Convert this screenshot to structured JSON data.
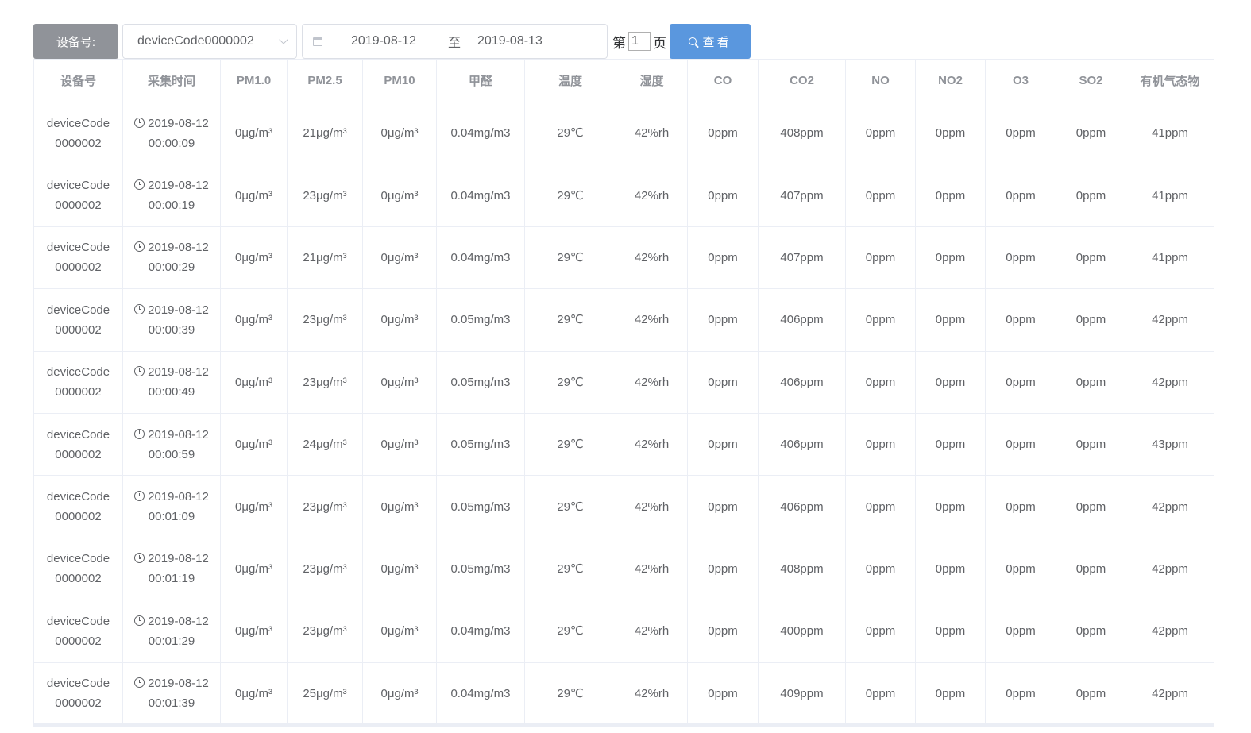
{
  "toolbar": {
    "device_label": "设备号:",
    "device_value": "deviceCode0000002",
    "date_start": "2019-08-12",
    "date_sep": "至",
    "date_end": "2019-08-13",
    "page_prefix": "第",
    "page_value": "1",
    "page_suffix": "页",
    "search_label": "查看",
    "accent_color": "#5a97de"
  },
  "table": {
    "columns": [
      "设备号",
      "采集时间",
      "PM1.0",
      "PM2.5",
      "PM10",
      "甲醛",
      "温度",
      "湿度",
      "CO",
      "CO2",
      "NO",
      "NO2",
      "O3",
      "SO2",
      "有机气态物"
    ],
    "rows": [
      {
        "device": "deviceCode",
        "device2": "0000002",
        "date": "2019-08-12",
        "time": "00:00:09",
        "pm1": "0μg/m³",
        "pm25": "21μg/m³",
        "pm10": "0μg/m³",
        "hcho": "0.04mg/m3",
        "temp": "29℃",
        "hum": "42%rh",
        "co": "0ppm",
        "co2": "408ppm",
        "no": "0ppm",
        "no2": "0ppm",
        "o3": "0ppm",
        "so2": "0ppm",
        "voc": "41ppm"
      },
      {
        "device": "deviceCode",
        "device2": "0000002",
        "date": "2019-08-12",
        "time": "00:00:19",
        "pm1": "0μg/m³",
        "pm25": "23μg/m³",
        "pm10": "0μg/m³",
        "hcho": "0.04mg/m3",
        "temp": "29℃",
        "hum": "42%rh",
        "co": "0ppm",
        "co2": "407ppm",
        "no": "0ppm",
        "no2": "0ppm",
        "o3": "0ppm",
        "so2": "0ppm",
        "voc": "41ppm"
      },
      {
        "device": "deviceCode",
        "device2": "0000002",
        "date": "2019-08-12",
        "time": "00:00:29",
        "pm1": "0μg/m³",
        "pm25": "21μg/m³",
        "pm10": "0μg/m³",
        "hcho": "0.04mg/m3",
        "temp": "29℃",
        "hum": "42%rh",
        "co": "0ppm",
        "co2": "407ppm",
        "no": "0ppm",
        "no2": "0ppm",
        "o3": "0ppm",
        "so2": "0ppm",
        "voc": "41ppm"
      },
      {
        "device": "deviceCode",
        "device2": "0000002",
        "date": "2019-08-12",
        "time": "00:00:39",
        "pm1": "0μg/m³",
        "pm25": "23μg/m³",
        "pm10": "0μg/m³",
        "hcho": "0.05mg/m3",
        "temp": "29℃",
        "hum": "42%rh",
        "co": "0ppm",
        "co2": "406ppm",
        "no": "0ppm",
        "no2": "0ppm",
        "o3": "0ppm",
        "so2": "0ppm",
        "voc": "42ppm"
      },
      {
        "device": "deviceCode",
        "device2": "0000002",
        "date": "2019-08-12",
        "time": "00:00:49",
        "pm1": "0μg/m³",
        "pm25": "23μg/m³",
        "pm10": "0μg/m³",
        "hcho": "0.05mg/m3",
        "temp": "29℃",
        "hum": "42%rh",
        "co": "0ppm",
        "co2": "406ppm",
        "no": "0ppm",
        "no2": "0ppm",
        "o3": "0ppm",
        "so2": "0ppm",
        "voc": "42ppm"
      },
      {
        "device": "deviceCode",
        "device2": "0000002",
        "date": "2019-08-12",
        "time": "00:00:59",
        "pm1": "0μg/m³",
        "pm25": "24μg/m³",
        "pm10": "0μg/m³",
        "hcho": "0.05mg/m3",
        "temp": "29℃",
        "hum": "42%rh",
        "co": "0ppm",
        "co2": "406ppm",
        "no": "0ppm",
        "no2": "0ppm",
        "o3": "0ppm",
        "so2": "0ppm",
        "voc": "43ppm"
      },
      {
        "device": "deviceCode",
        "device2": "0000002",
        "date": "2019-08-12",
        "time": "00:01:09",
        "pm1": "0μg/m³",
        "pm25": "23μg/m³",
        "pm10": "0μg/m³",
        "hcho": "0.05mg/m3",
        "temp": "29℃",
        "hum": "42%rh",
        "co": "0ppm",
        "co2": "406ppm",
        "no": "0ppm",
        "no2": "0ppm",
        "o3": "0ppm",
        "so2": "0ppm",
        "voc": "42ppm"
      },
      {
        "device": "deviceCode",
        "device2": "0000002",
        "date": "2019-08-12",
        "time": "00:01:19",
        "pm1": "0μg/m³",
        "pm25": "23μg/m³",
        "pm10": "0μg/m³",
        "hcho": "0.05mg/m3",
        "temp": "29℃",
        "hum": "42%rh",
        "co": "0ppm",
        "co2": "408ppm",
        "no": "0ppm",
        "no2": "0ppm",
        "o3": "0ppm",
        "so2": "0ppm",
        "voc": "42ppm"
      },
      {
        "device": "deviceCode",
        "device2": "0000002",
        "date": "2019-08-12",
        "time": "00:01:29",
        "pm1": "0μg/m³",
        "pm25": "23μg/m³",
        "pm10": "0μg/m³",
        "hcho": "0.04mg/m3",
        "temp": "29℃",
        "hum": "42%rh",
        "co": "0ppm",
        "co2": "400ppm",
        "no": "0ppm",
        "no2": "0ppm",
        "o3": "0ppm",
        "so2": "0ppm",
        "voc": "42ppm"
      },
      {
        "device": "deviceCode",
        "device2": "0000002",
        "date": "2019-08-12",
        "time": "00:01:39",
        "pm1": "0μg/m³",
        "pm25": "25μg/m³",
        "pm10": "0μg/m³",
        "hcho": "0.04mg/m3",
        "temp": "29℃",
        "hum": "42%rh",
        "co": "0ppm",
        "co2": "409ppm",
        "no": "0ppm",
        "no2": "0ppm",
        "o3": "0ppm",
        "so2": "0ppm",
        "voc": "42ppm"
      }
    ]
  }
}
